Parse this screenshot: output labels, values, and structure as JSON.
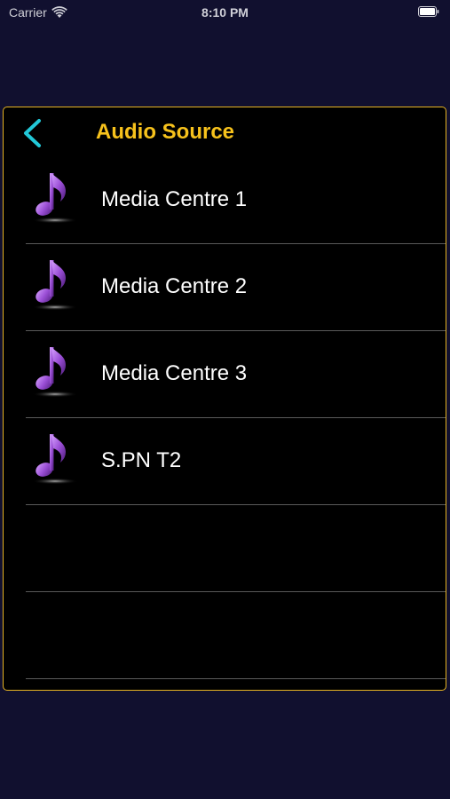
{
  "status_bar": {
    "carrier": "Carrier",
    "time": "8:10 PM"
  },
  "header": {
    "title": "Audio Source",
    "back_icon": "chevron-left-icon"
  },
  "colors": {
    "page_background": "#11102f",
    "panel_border": "#e6b422",
    "title": "#f7c21c",
    "back_arrow": "#22c8d8",
    "note": "#9b4fd6"
  },
  "sources": [
    {
      "label": "Media Centre 1",
      "icon": "music-note-icon"
    },
    {
      "label": "Media Centre 2",
      "icon": "music-note-icon"
    },
    {
      "label": "Media Centre 3",
      "icon": "music-note-icon"
    },
    {
      "label": "S.PN T2",
      "icon": "music-note-icon"
    },
    {
      "label": "",
      "icon": ""
    },
    {
      "label": "",
      "icon": ""
    }
  ]
}
